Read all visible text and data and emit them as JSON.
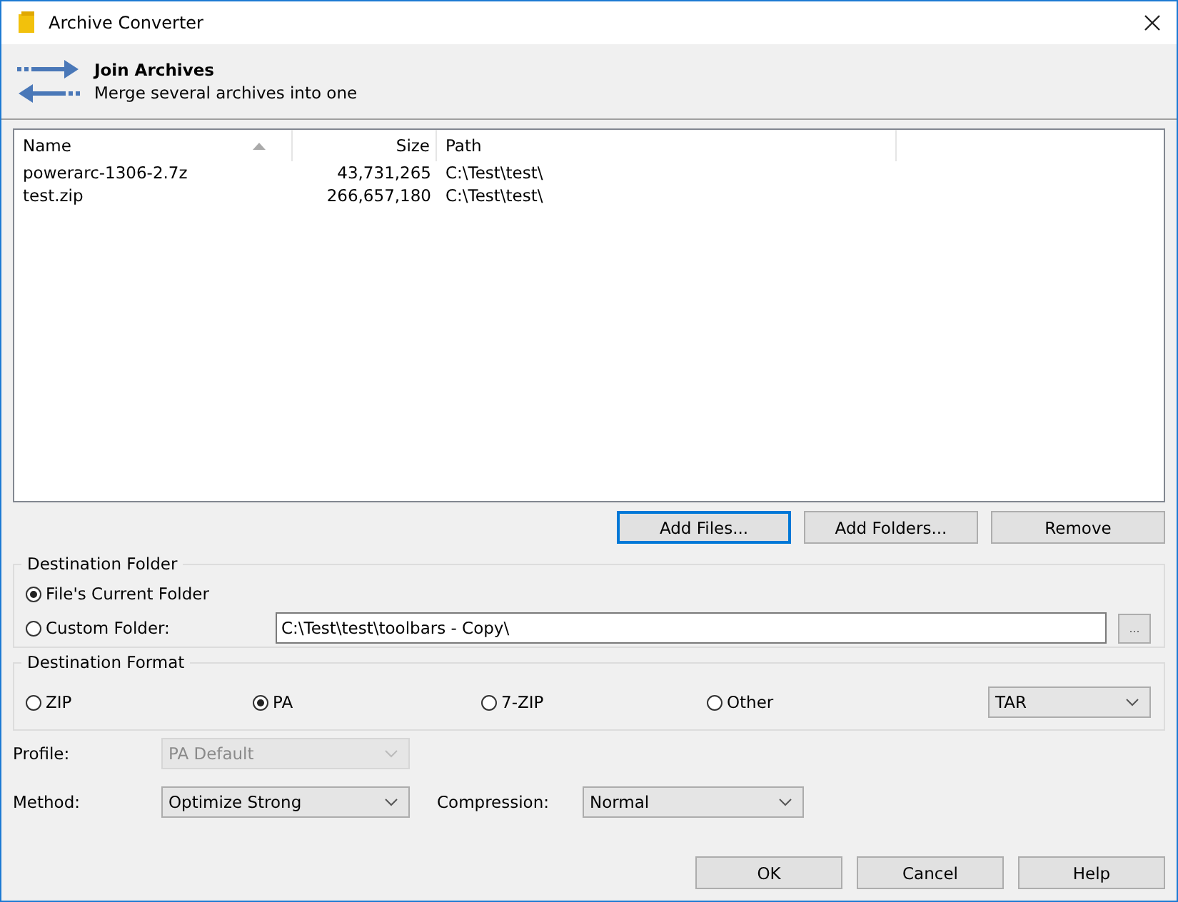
{
  "window": {
    "title": "Archive Converter"
  },
  "header": {
    "title": "Join Archives",
    "subtitle": "Merge several archives into one"
  },
  "file_list": {
    "columns": [
      {
        "label": "Name",
        "sorted": true
      },
      {
        "label": "Size",
        "sorted": false
      },
      {
        "label": "Path",
        "sorted": false
      }
    ],
    "rows": [
      [
        "powerarc-1306-2.7z",
        "43,731,265",
        "C:\\Test\\test\\"
      ],
      [
        "test.zip",
        "266,657,180",
        "C:\\Test\\test\\"
      ]
    ]
  },
  "list_buttons": [
    {
      "label": "Add Files...",
      "focused": true
    },
    {
      "label": "Add Folders...",
      "focused": false
    },
    {
      "label": "Remove",
      "focused": false
    }
  ],
  "destination_folder": {
    "title": "Destination Folder",
    "options": [
      {
        "label": "File's Current Folder",
        "selected": true
      },
      {
        "label": "Custom Folder:",
        "selected": false
      }
    ],
    "custom_path": "C:\\Test\\test\\toolbars - Copy\\",
    "browse_button": "..."
  },
  "destination_format": {
    "title": "Destination Format",
    "options": [
      {
        "label": "ZIP",
        "selected": false
      },
      {
        "label": "PA",
        "selected": true
      },
      {
        "label": "7-ZIP",
        "selected": false
      },
      {
        "label": "Other",
        "selected": false
      }
    ],
    "other_format": "TAR"
  },
  "settings": [
    {
      "label": "Profile:",
      "value": "PA Default",
      "disabled": true
    },
    {
      "label": "Method:",
      "value": "Optimize Strong",
      "disabled": false
    }
  ],
  "compression": {
    "label": "Compression:",
    "value": "Normal"
  },
  "buttons": [
    "OK",
    "Cancel",
    "Help"
  ]
}
